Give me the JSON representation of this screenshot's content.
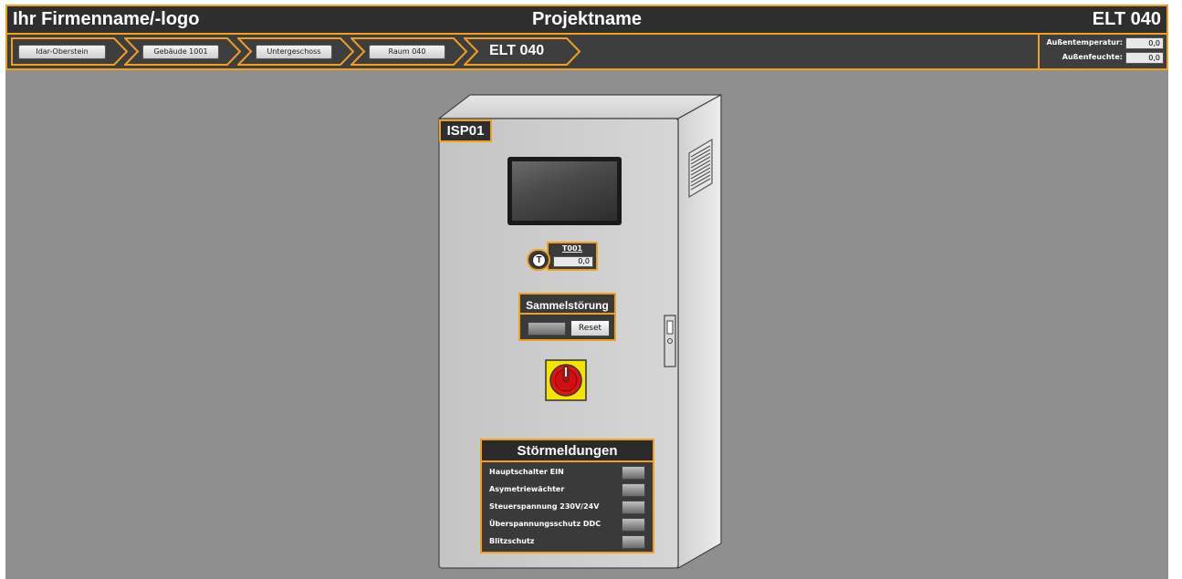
{
  "header": {
    "company": "Ihr Firmenname/-logo",
    "project": "Projektname",
    "location_code": "ELT 040"
  },
  "breadcrumb": {
    "items": [
      {
        "label": "Idar-Oberstein"
      },
      {
        "label": "Gebäude 1001"
      },
      {
        "label": "Untergeschoss"
      },
      {
        "label": "Raum 040"
      }
    ],
    "current": "ELT 040"
  },
  "environment": {
    "temp_label": "Außentemperatur:",
    "temp_value": "0,0",
    "humidity_label": "Außenfeuchte:",
    "humidity_value": "0,0"
  },
  "cabinet": {
    "tag": "ISP01",
    "temperature": {
      "name": "T001",
      "symbol": "T",
      "value": "0,0"
    },
    "collective_fault": {
      "title": "Sammelstörung",
      "reset_label": "Reset"
    },
    "faults": {
      "title": "Störmeldungen",
      "items": [
        {
          "label": "Hauptschalter EIN"
        },
        {
          "label": "Asymetriewächter"
        },
        {
          "label": "Steuerspannung 230V/24V"
        },
        {
          "label": "Überspannungsschutz DDC"
        },
        {
          "label": "Blitzschutz"
        }
      ]
    }
  },
  "colors": {
    "accent": "#f0a020",
    "background": "#8f8f8f",
    "bar": "#2e2e2e"
  }
}
